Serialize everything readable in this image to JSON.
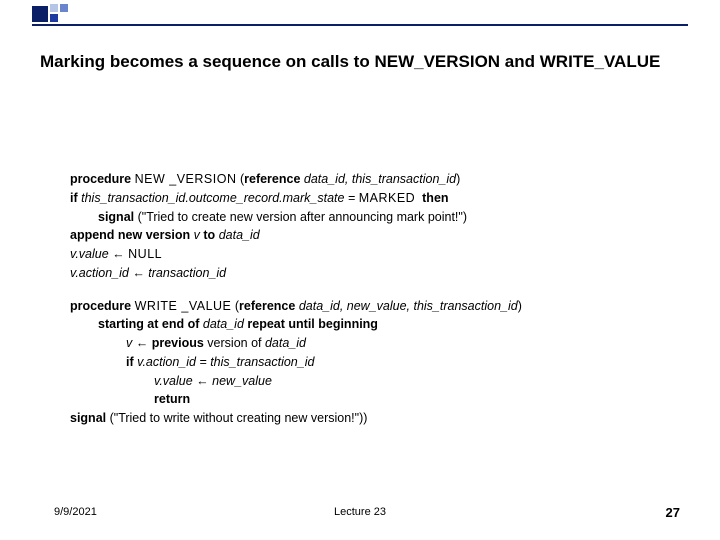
{
  "title": "Marking becomes a sequence on calls to NEW_VERSION and WRITE_VALUE",
  "proc": {
    "kw_procedure": "procedure",
    "kw_if": "if",
    "kw_then": "then",
    "kw_signal": "signal",
    "kw_append": "append new version",
    "kw_to": "to",
    "kw_reference": "reference",
    "new_version_name": "NEW _VERSION",
    "new_version_params": "data_id, this_transaction_id",
    "nv_cond": "this_transaction_id.outcome_record.mark_state = ",
    "nv_marked": "MARKED",
    "nv_signal_msg": " (\"Tried to create new version after announcing mark point!\")",
    "nv_v": "v",
    "nv_dataid": "data_id",
    "nv_assign1_lhs": "v.value",
    "nv_assign1_rhs": "NULL",
    "nv_assign2_lhs": "v.action_id",
    "nv_assign2_rhs": "transaction_id",
    "write_value_name": "WRITE _VALUE",
    "write_value_params": "data_id, new_value, this_transaction_id",
    "kw_starting": "starting at end of",
    "kw_repeat": "repeat until beginning",
    "wv_dataid": "data_id",
    "kw_previous": "previous",
    "kw_version_of": "version of",
    "wv_v": "v",
    "wv_if_cond": "v.action_id = this_transaction_id",
    "wv_assign_lhs": "v.value",
    "wv_assign_rhs": "new_value",
    "kw_return": "return",
    "wv_signal_msg": " (\"Tried to write without creating new version!\"))"
  },
  "arrow": " ← ",
  "footer": {
    "date": "9/9/2021",
    "center": "Lecture 23",
    "page": "27"
  }
}
